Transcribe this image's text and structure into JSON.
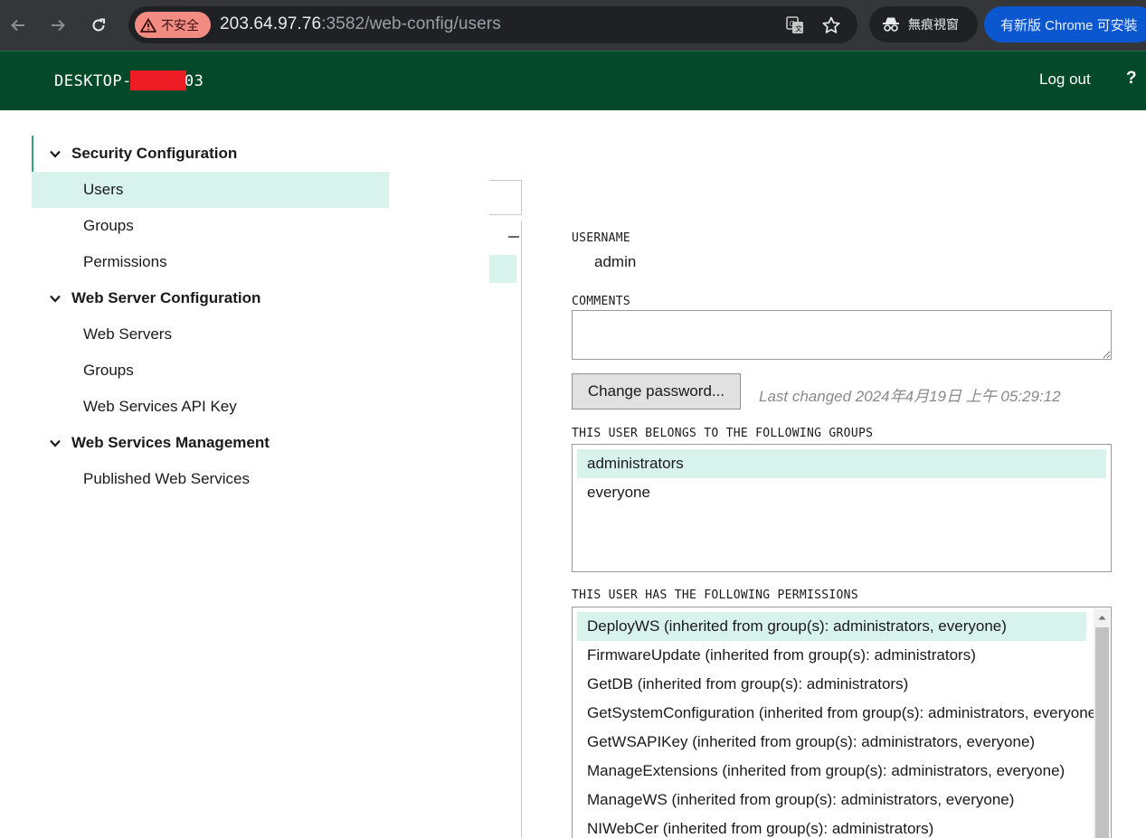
{
  "browser": {
    "security_label": "不安全",
    "url_host": "203.64.97.76",
    "url_rest": ":3582/web-config/users",
    "incognito_label": "無痕視窗",
    "update_label": "有新版 Chrome 可安裝"
  },
  "header": {
    "host_prefix": "DESKTOP-",
    "host_suffix": "03",
    "logout_label": "Log out",
    "help_label": "?"
  },
  "sidebar": {
    "sections": [
      {
        "title": "Security Configuration",
        "items": [
          "Users",
          "Groups",
          "Permissions"
        ]
      },
      {
        "title": "Web Server Configuration",
        "items": [
          "Web Servers",
          "Groups",
          "Web Services API Key"
        ]
      },
      {
        "title": "Web Services Management",
        "items": [
          "Published Web Services"
        ]
      }
    ],
    "active_item": "Users"
  },
  "detail": {
    "username_label": "USERNAME",
    "username_value": "admin",
    "comments_label": "COMMENTS",
    "comments_value": "",
    "change_password_label": "Change password...",
    "last_changed": "Last changed 2024年4月19日 上午 05:29:12",
    "groups_label": "THIS USER BELONGS TO THE FOLLOWING GROUPS",
    "groups": [
      "administrators",
      "everyone"
    ],
    "permissions_label": "THIS USER HAS THE FOLLOWING PERMISSIONS",
    "permissions": [
      "DeployWS (inherited from group(s): administrators, everyone)",
      "FirmwareUpdate (inherited from group(s): administrators)",
      "GetDB (inherited from group(s): administrators)",
      "GetSystemConfiguration (inherited from group(s): administrators, everyone)",
      "GetWSAPIKey (inherited from group(s): administrators, everyone)",
      "ManageExtensions (inherited from group(s): administrators, everyone)",
      "ManageWS (inherited from group(s): administrators, everyone)",
      "NIWebCer (inherited from group(s): administrators)"
    ]
  },
  "colors": {
    "header_bg": "#03492a",
    "selection": "#d8f3ec",
    "accent": "#2fa37c"
  }
}
